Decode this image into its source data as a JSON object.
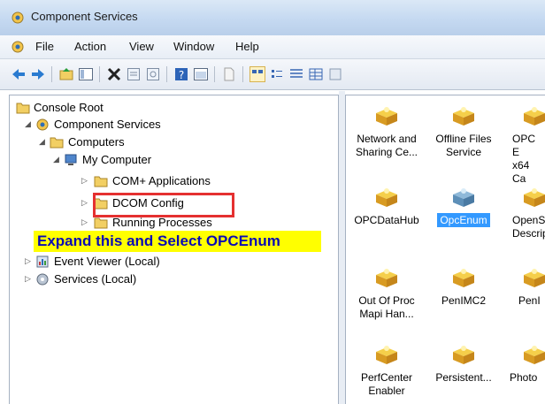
{
  "window": {
    "title": "Component Services"
  },
  "menu": {
    "items": [
      "File",
      "Action",
      "View",
      "Window",
      "Help"
    ]
  },
  "toolbar": {
    "buttons": [
      "back-icon",
      "forward-icon",
      "up-folder-icon",
      "show-tree-icon",
      "delete-icon",
      "properties-icon",
      "refresh-icon",
      "help-icon",
      "console-icon",
      "new-icon",
      "large-icons-view-icon",
      "small-icons-view-icon",
      "list-view-icon",
      "details-view-icon",
      "export-icon"
    ]
  },
  "tree": {
    "console_root": "Console Root",
    "component_services": "Component Services",
    "computers": "Computers",
    "my_computer": "My Computer",
    "com_apps": "COM+ Applications",
    "dcom_config": "DCOM Config",
    "running_processes": "Running Processes",
    "event_viewer": "Event Viewer (Local)",
    "services": "Services (Local)"
  },
  "annotation": {
    "text": "Expand this and Select OPCEnum"
  },
  "components": [
    {
      "line1": "Network and",
      "line2": "Sharing Ce..."
    },
    {
      "line1": "Offline Files",
      "line2": "Service"
    },
    {
      "line1": "OPC E",
      "line2": "x64 Ca"
    },
    {
      "line1": "OPCDataHub",
      "line2": ""
    },
    {
      "line1": "OpcEnum",
      "line2": "",
      "selected": true
    },
    {
      "line1": "OpenS",
      "line2": "Descrip"
    },
    {
      "line1": "Out Of Proc",
      "line2": "Mapi Han..."
    },
    {
      "line1": "PenIMC2",
      "line2": ""
    },
    {
      "line1": "PenI",
      "line2": ""
    },
    {
      "line1": "PerfCenter",
      "line2": "Enabler"
    },
    {
      "line1": "Persistent...",
      "line2": ""
    },
    {
      "line1": "Photo",
      "line2": ""
    }
  ],
  "colors": {
    "selection": "#3399ff",
    "highlight_border": "#e53030",
    "annotation_bg": "#ffff00",
    "annotation_text": "#0a0ab4"
  }
}
